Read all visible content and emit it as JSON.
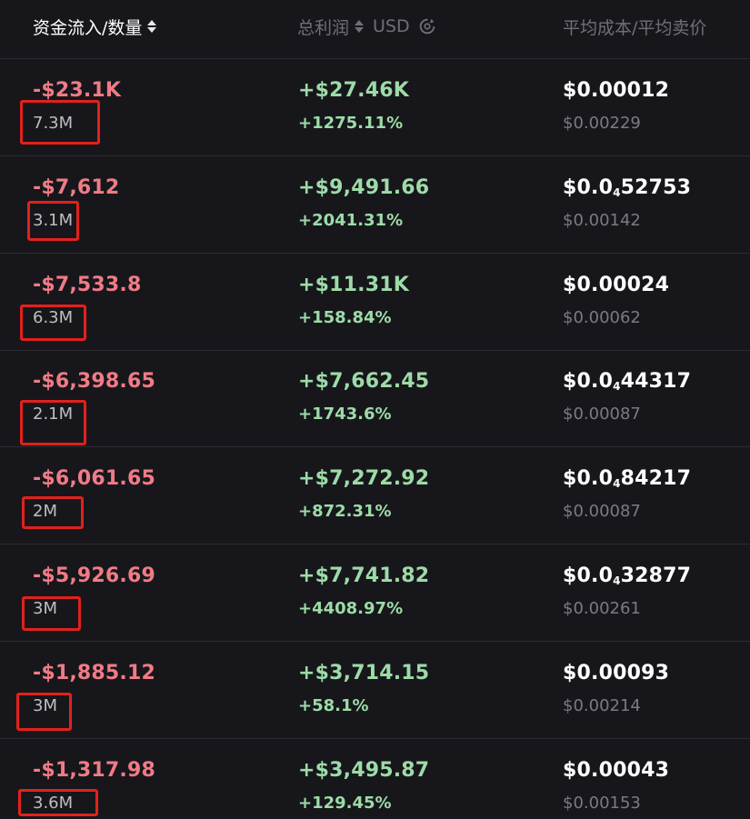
{
  "header": {
    "col1_label": "资金流入/数量",
    "col2_label": "总利润",
    "col2_currency": "USD",
    "col3_label": "平均成本/平均卖价"
  },
  "rows": [
    {
      "inflow": "-$23.1K",
      "quantity": "7.3M",
      "profit": "+$27.46K",
      "profit_pct": "+1275.11%",
      "avg_cost": "$0.00012",
      "avg_cost_parts": null,
      "avg_sell": "$0.00229"
    },
    {
      "inflow": "-$7,612",
      "quantity": "3.1M",
      "profit": "+$9,491.66",
      "profit_pct": "+2041.31%",
      "avg_cost": "$0.0₄52753",
      "avg_cost_parts": {
        "prefix": "$0.0",
        "zeros": "4",
        "digits": "52753"
      },
      "avg_sell": "$0.00142"
    },
    {
      "inflow": "-$7,533.8",
      "quantity": "6.3M",
      "profit": "+$11.31K",
      "profit_pct": "+158.84%",
      "avg_cost": "$0.00024",
      "avg_cost_parts": null,
      "avg_sell": "$0.00062"
    },
    {
      "inflow": "-$6,398.65",
      "quantity": "2.1M",
      "profit": "+$7,662.45",
      "profit_pct": "+1743.6%",
      "avg_cost": "$0.0₄44317",
      "avg_cost_parts": {
        "prefix": "$0.0",
        "zeros": "4",
        "digits": "44317"
      },
      "avg_sell": "$0.00087"
    },
    {
      "inflow": "-$6,061.65",
      "quantity": "2M",
      "profit": "+$7,272.92",
      "profit_pct": "+872.31%",
      "avg_cost": "$0.0₄84217",
      "avg_cost_parts": {
        "prefix": "$0.0",
        "zeros": "4",
        "digits": "84217"
      },
      "avg_sell": "$0.00087"
    },
    {
      "inflow": "-$5,926.69",
      "quantity": "3M",
      "profit": "+$7,741.82",
      "profit_pct": "+4408.97%",
      "avg_cost": "$0.0₄32877",
      "avg_cost_parts": {
        "prefix": "$0.0",
        "zeros": "4",
        "digits": "32877"
      },
      "avg_sell": "$0.00261"
    },
    {
      "inflow": "-$1,885.12",
      "quantity": "3M",
      "profit": "+$3,714.15",
      "profit_pct": "+58.1%",
      "avg_cost": "$0.00093",
      "avg_cost_parts": null,
      "avg_sell": "$0.00214"
    },
    {
      "inflow": "-$1,317.98",
      "quantity": "3.6M",
      "profit": "+$3,495.87",
      "profit_pct": "+129.45%",
      "avg_cost": "$0.00043",
      "avg_cost_parts": null,
      "avg_sell": "$0.00153"
    }
  ],
  "colors": {
    "background": "#17171b",
    "negative": "#f07b86",
    "positive": "#9ddba8",
    "highlight_box": "#e2211c"
  }
}
